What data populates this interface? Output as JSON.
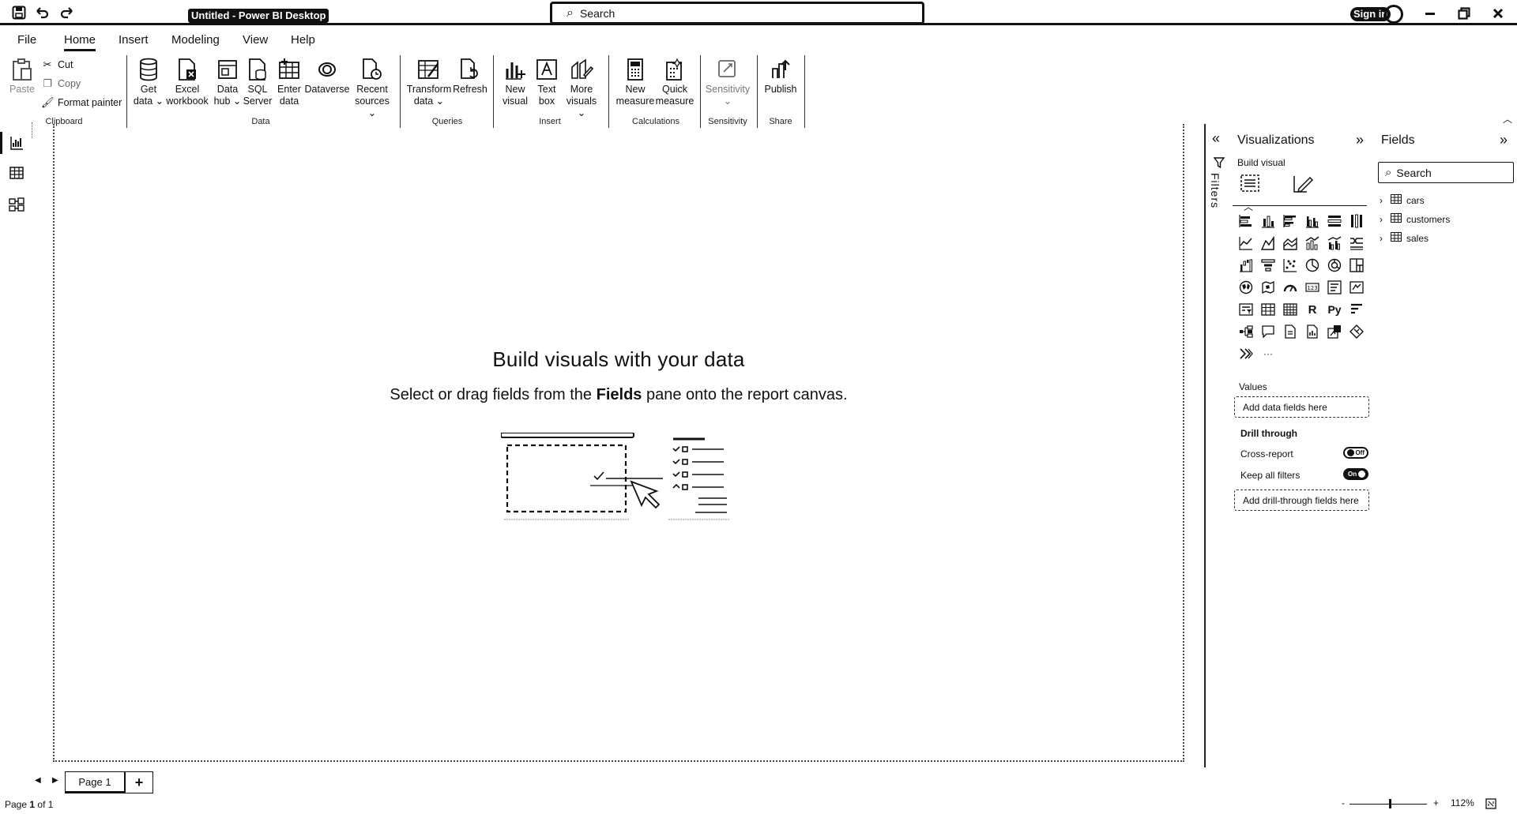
{
  "titlebar": {
    "title": "Untitled - Power BI Desktop",
    "search_placeholder": "Search",
    "signin": "Sign in"
  },
  "menu": [
    "File",
    "Home",
    "Insert",
    "Modeling",
    "View",
    "Help"
  ],
  "ribbon": {
    "clipboard": {
      "paste": "Paste",
      "cut": "Cut",
      "copy": "Copy",
      "format_painter": "Format painter",
      "group": "Clipboard"
    },
    "data": {
      "get_data": [
        "Get",
        "data"
      ],
      "excel": [
        "Excel",
        "workbook"
      ],
      "data_hub": [
        "Data",
        "hub"
      ],
      "sql": [
        "SQL",
        "Server"
      ],
      "enter": [
        "Enter",
        "data"
      ],
      "dataverse": "Dataverse",
      "recent": [
        "Recent",
        "sources"
      ],
      "group": "Data"
    },
    "queries": {
      "transform": [
        "Transform",
        "data"
      ],
      "refresh": "Refresh",
      "group": "Queries"
    },
    "insert": {
      "new_visual": [
        "New",
        "visual"
      ],
      "text_box": [
        "Text",
        "box"
      ],
      "more_visuals": [
        "More",
        "visuals"
      ],
      "group": "Insert"
    },
    "calculations": {
      "new_measure": [
        "New",
        "measure"
      ],
      "quick_measure": [
        "Quick",
        "measure"
      ],
      "group": "Calculations"
    },
    "sensitivity": {
      "label": "Sensitivity",
      "group": "Sensitivity"
    },
    "share": {
      "publish": "Publish",
      "group": "Share"
    }
  },
  "canvas": {
    "title": "Build visuals with your data",
    "subtitle_before": "Select or drag fields from the",
    "subtitle_bold": "Fields",
    "subtitle_after": "pane onto the report canvas."
  },
  "filters": {
    "label": "Filters"
  },
  "visualizations": {
    "title": "Visualizations",
    "build_visual": "Build visual",
    "values_label": "Values",
    "add_data_fields": "Add data fields here",
    "drill_through": "Drill through",
    "cross_report": "Cross-report",
    "cross_report_state": "Off",
    "keep_all_filters": "Keep all filters",
    "keep_all_filters_state": "On",
    "add_drill_through": "Add drill-through fields here",
    "more": "···",
    "r_label": "R",
    "py_label": "Py",
    "card_label": "123"
  },
  "fields": {
    "title": "Fields",
    "search_placeholder": "Search",
    "tables": [
      "cars",
      "customers",
      "sales"
    ]
  },
  "bottom": {
    "page_tab": "Page 1",
    "add_page": "+",
    "status_prefix": "Page",
    "status_current": "1",
    "status_suffix": "of 1",
    "zoom_minus": "-",
    "zoom_plus": "+",
    "zoom": "112%"
  }
}
